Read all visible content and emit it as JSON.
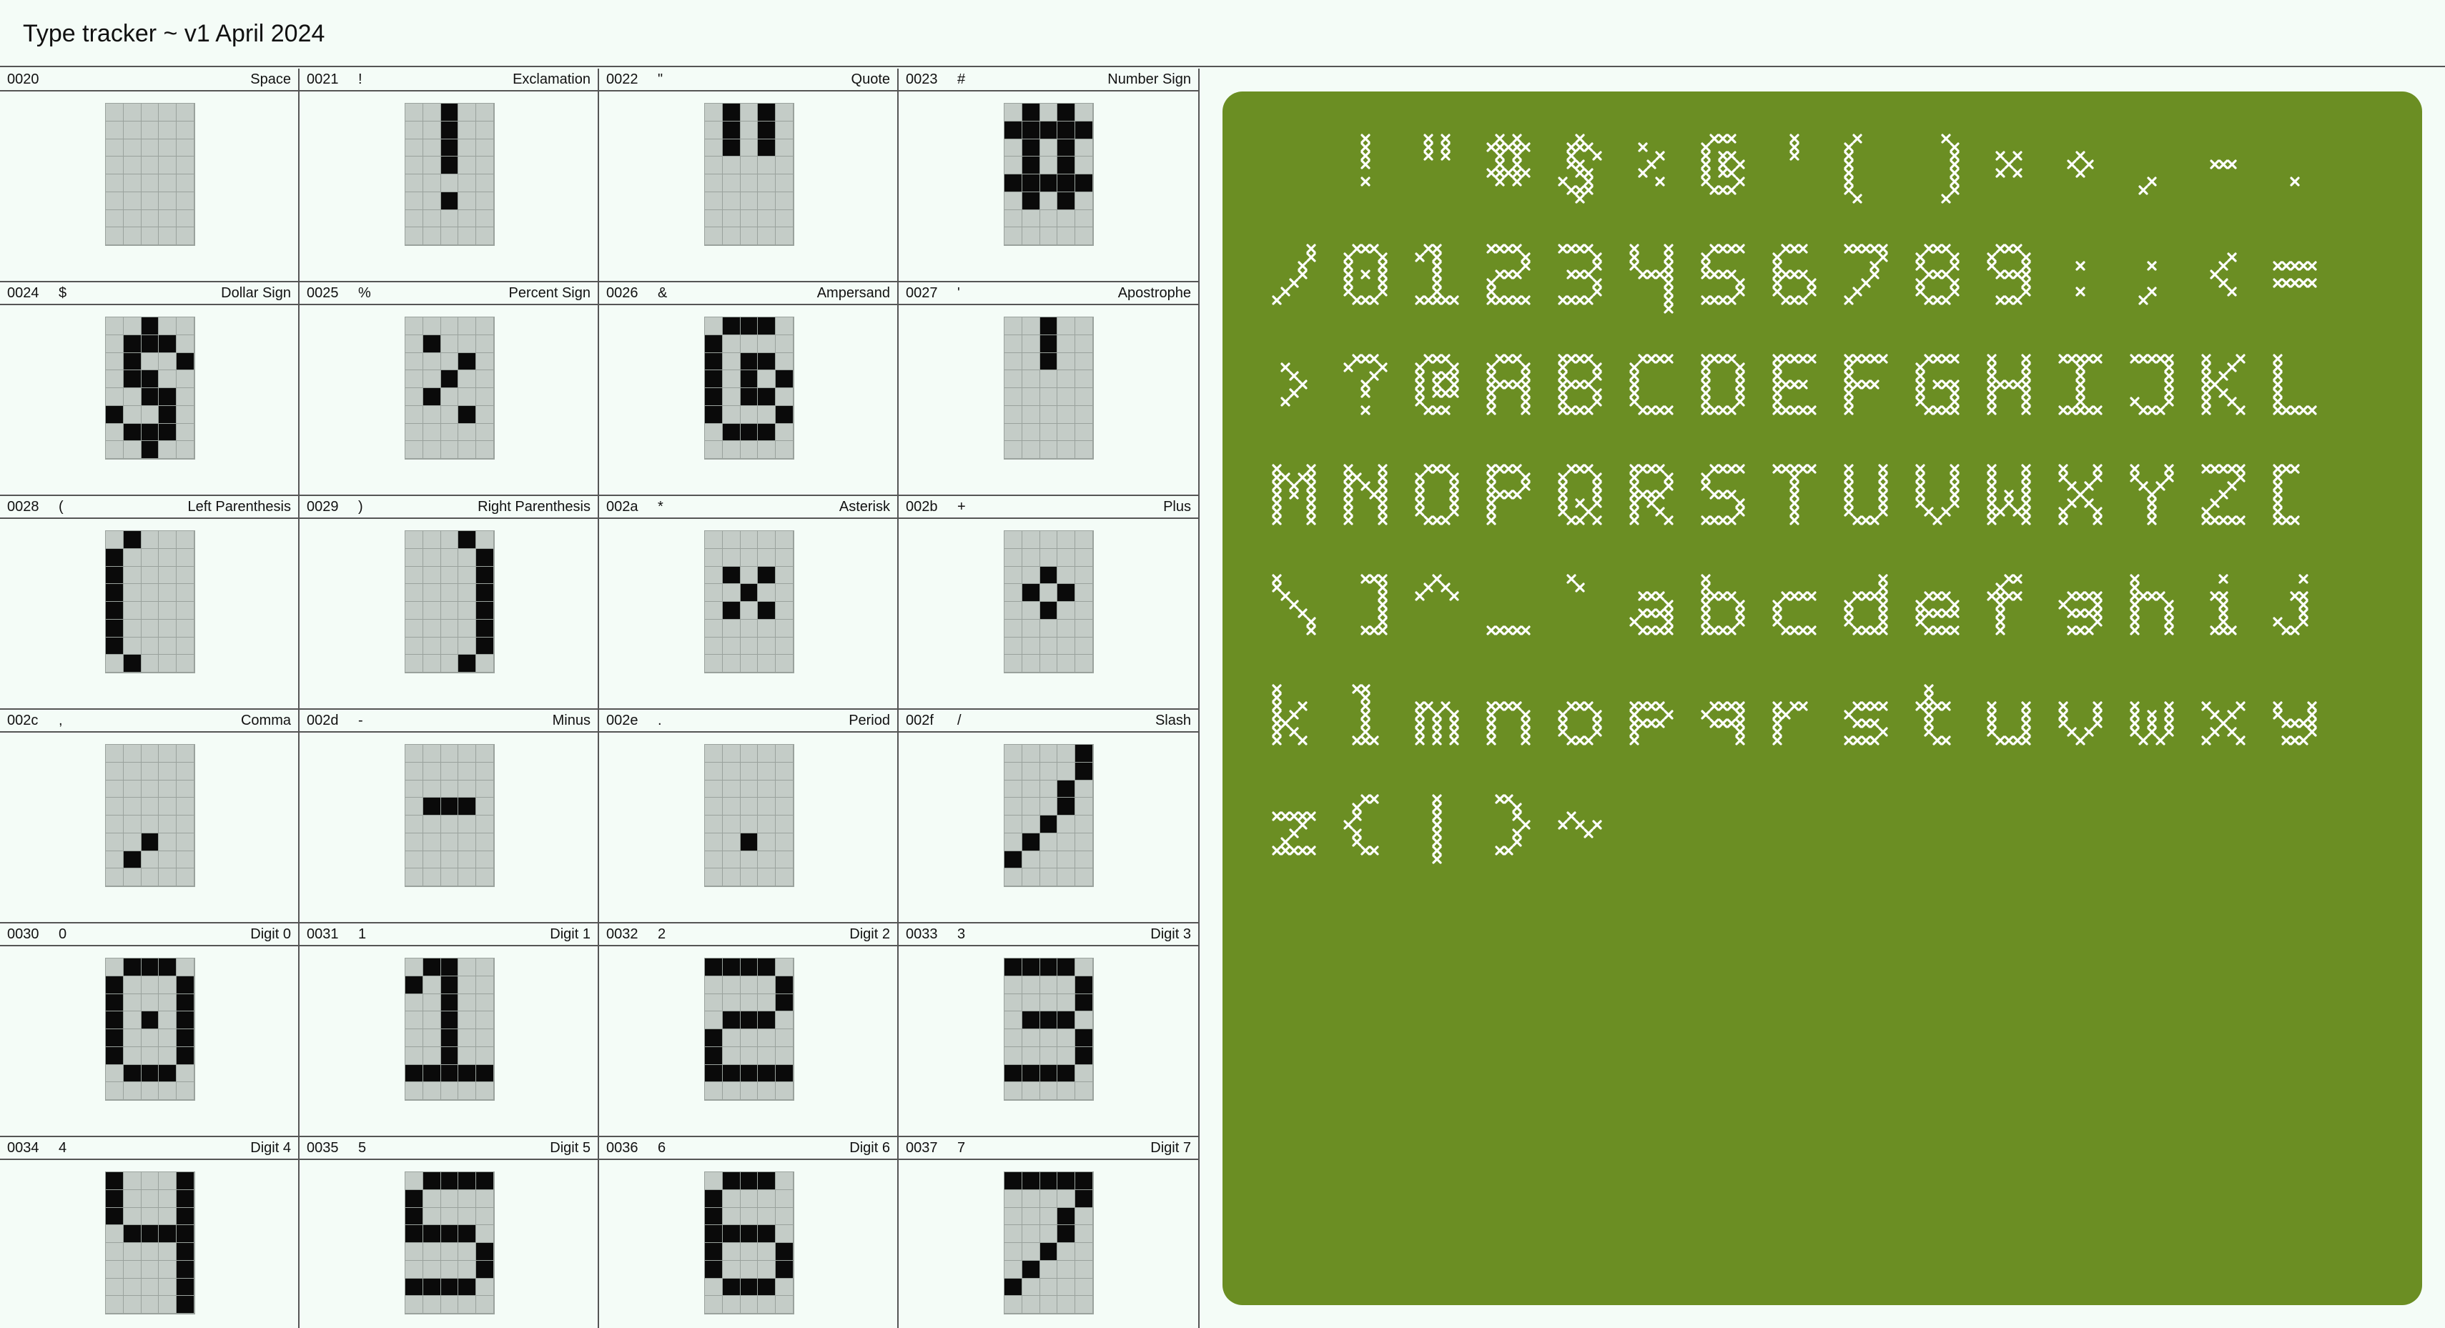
{
  "header": {
    "title": "Type tracker ~ v1 April 2024"
  },
  "colors": {
    "background": "#f4fcf7",
    "pixel_on": "#0a0a0a",
    "pixel_off": "#c4ccc7",
    "preview_bg": "#6b8e23",
    "stitch": "#ffffff"
  },
  "glyphs": [
    {
      "code": "0020",
      "char": "",
      "name": "Space",
      "rows": [
        "00000",
        "00000",
        "00000",
        "00000",
        "00000",
        "00000",
        "00000",
        "00000"
      ]
    },
    {
      "code": "0021",
      "char": "!",
      "name": "Exclamation",
      "rows": [
        "00100",
        "00100",
        "00100",
        "00100",
        "00000",
        "00100",
        "00000",
        "00000"
      ]
    },
    {
      "code": "0022",
      "char": "\"",
      "name": "Quote",
      "rows": [
        "01010",
        "01010",
        "01010",
        "00000",
        "00000",
        "00000",
        "00000",
        "00000"
      ]
    },
    {
      "code": "0023",
      "char": "#",
      "name": "Number Sign",
      "rows": [
        "01010",
        "11111",
        "01010",
        "01010",
        "11111",
        "01010",
        "00000",
        "00000"
      ]
    },
    {
      "code": "0024",
      "char": "$",
      "name": "Dollar Sign",
      "rows": [
        "00100",
        "01110",
        "01001",
        "01100",
        "00110",
        "10010",
        "01110",
        "00100"
      ]
    },
    {
      "code": "0025",
      "char": "%",
      "name": "Percent Sign",
      "rows": [
        "00000",
        "01000",
        "00010",
        "00100",
        "01000",
        "00010",
        "00000",
        "00000"
      ]
    },
    {
      "code": "0026",
      "char": "&",
      "name": "Ampersand",
      "rows": [
        "01110",
        "10000",
        "10110",
        "10101",
        "10110",
        "10001",
        "01110",
        "00000"
      ]
    },
    {
      "code": "0027",
      "char": "'",
      "name": "Apostrophe",
      "rows": [
        "00100",
        "00100",
        "00100",
        "00000",
        "00000",
        "00000",
        "00000",
        "00000"
      ]
    },
    {
      "code": "0028",
      "char": "(",
      "name": "Left Parenthesis",
      "rows": [
        "01000",
        "10000",
        "10000",
        "10000",
        "10000",
        "10000",
        "10000",
        "01000"
      ]
    },
    {
      "code": "0029",
      "char": ")",
      "name": "Right Parenthesis",
      "rows": [
        "00010",
        "00001",
        "00001",
        "00001",
        "00001",
        "00001",
        "00001",
        "00010"
      ]
    },
    {
      "code": "002a",
      "char": "*",
      "name": "Asterisk",
      "rows": [
        "00000",
        "00000",
        "01010",
        "00100",
        "01010",
        "00000",
        "00000",
        "00000"
      ]
    },
    {
      "code": "002b",
      "char": "+",
      "name": "Plus",
      "rows": [
        "00000",
        "00000",
        "00100",
        "01010",
        "00100",
        "00000",
        "00000",
        "00000"
      ]
    },
    {
      "code": "002c",
      "char": ",",
      "name": "Comma",
      "rows": [
        "00000",
        "00000",
        "00000",
        "00000",
        "00000",
        "00100",
        "01000",
        "00000"
      ]
    },
    {
      "code": "002d",
      "char": "-",
      "name": "Minus",
      "rows": [
        "00000",
        "00000",
        "00000",
        "01110",
        "00000",
        "00000",
        "00000",
        "00000"
      ]
    },
    {
      "code": "002e",
      "char": ".",
      "name": "Period",
      "rows": [
        "00000",
        "00000",
        "00000",
        "00000",
        "00000",
        "00100",
        "00000",
        "00000"
      ]
    },
    {
      "code": "002f",
      "char": "/",
      "name": "Slash",
      "rows": [
        "00001",
        "00001",
        "00010",
        "00010",
        "00100",
        "01000",
        "10000",
        "00000"
      ]
    },
    {
      "code": "0030",
      "char": "0",
      "name": "Digit 0",
      "rows": [
        "01110",
        "10001",
        "10001",
        "10101",
        "10001",
        "10001",
        "01110",
        "00000"
      ]
    },
    {
      "code": "0031",
      "char": "1",
      "name": "Digit 1",
      "rows": [
        "01100",
        "10100",
        "00100",
        "00100",
        "00100",
        "00100",
        "11111",
        "00000"
      ]
    },
    {
      "code": "0032",
      "char": "2",
      "name": "Digit 2",
      "rows": [
        "11110",
        "00001",
        "00001",
        "01110",
        "10000",
        "10000",
        "11111",
        "00000"
      ]
    },
    {
      "code": "0033",
      "char": "3",
      "name": "Digit 3",
      "rows": [
        "11110",
        "00001",
        "00001",
        "01110",
        "00001",
        "00001",
        "11110",
        "00000"
      ]
    },
    {
      "code": "0034",
      "char": "4",
      "name": "Digit 4",
      "rows": [
        "10001",
        "10001",
        "10001",
        "01111",
        "00001",
        "00001",
        "00001",
        "00001"
      ]
    },
    {
      "code": "0035",
      "char": "5",
      "name": "Digit 5",
      "rows": [
        "01111",
        "10000",
        "10000",
        "11110",
        "00001",
        "00001",
        "11110",
        "00000"
      ]
    },
    {
      "code": "0036",
      "char": "6",
      "name": "Digit 6",
      "rows": [
        "01110",
        "10000",
        "10000",
        "11110",
        "10001",
        "10001",
        "01110",
        "00000"
      ]
    },
    {
      "code": "0037",
      "char": "7",
      "name": "Digit 7",
      "rows": [
        "11111",
        "00001",
        "00010",
        "00010",
        "00100",
        "01000",
        "10000",
        "00000"
      ]
    }
  ],
  "preview_lines": [
    " !\"#$%&'()*+,-.",
    "/0123456789:;<=",
    ">?@ABCDEFGHIJKL",
    "MNOPQRSTUVWXYZ[",
    "\\]^_`abcdefghij",
    "klmnopqrstuvwxy",
    "z{|}~"
  ]
}
